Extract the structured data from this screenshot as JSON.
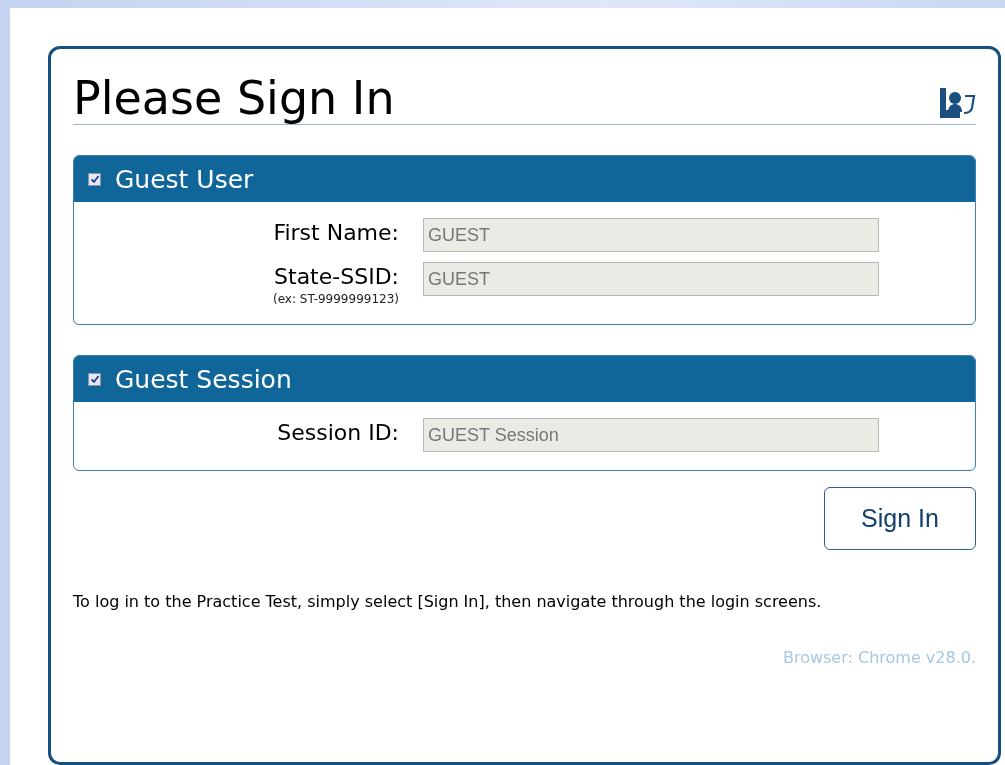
{
  "title": "Please Sign In",
  "sections": [
    {
      "title": "Guest User",
      "checked": true,
      "fields": [
        {
          "label": "First Name:",
          "value": "GUEST"
        },
        {
          "label": "State-SSID:",
          "note": "(ex: ST-9999999123)",
          "value": "GUEST"
        }
      ]
    },
    {
      "title": "Guest Session",
      "checked": true,
      "fields": [
        {
          "label": "Session ID:",
          "value": "GUEST Session"
        }
      ]
    }
  ],
  "button": "Sign In",
  "instructions": "To log in to the Practice Test, simply select [Sign In], then navigate through the login screens.",
  "browser_info": "Browser: Chrome v28.0."
}
